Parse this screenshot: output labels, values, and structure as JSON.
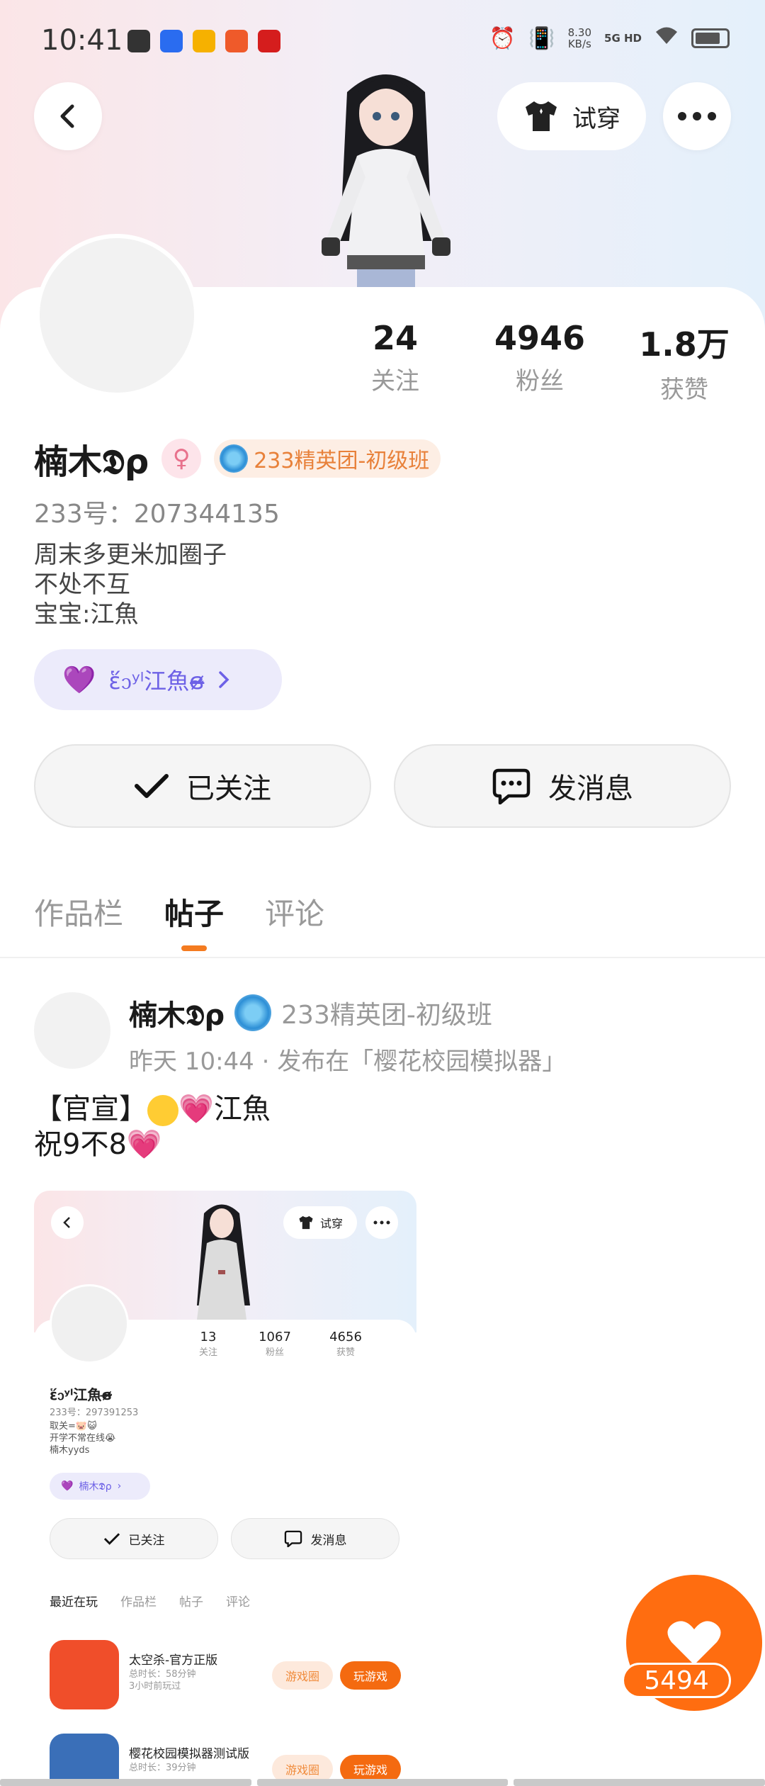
{
  "status_bar": {
    "time": "10:41",
    "net_speed_value": "8.30",
    "net_speed_unit": "KB/s",
    "network": "5G HD"
  },
  "header": {
    "try_on_label": "试穿"
  },
  "profile": {
    "stats": [
      {
        "value": "24",
        "label": "关注"
      },
      {
        "value": "4946",
        "label": "粉丝"
      },
      {
        "value": "1.8万",
        "label": "获赞"
      }
    ],
    "name": "楠木𝕯ρ",
    "rank_badge": "233精英团-初级班",
    "uid": "233号：207344135",
    "bio": [
      "周末多更米加圈子",
      "不处不互",
      "宝宝:江魚"
    ],
    "cp_name": "ἕ᧑ʸˡ江魚ɞ̴̶̷",
    "follow_label": "已关注",
    "message_label": "发消息"
  },
  "tabs": [
    {
      "label": "作品栏",
      "active": false
    },
    {
      "label": "帖子",
      "active": true
    },
    {
      "label": "评论",
      "active": false
    }
  ],
  "post": {
    "author": "楠木𝕯ρ",
    "rank": "233精英团-初级班",
    "meta": "昨天 10:44 · 发布在「樱花校园模拟器」",
    "line1_prefix": "【官宣】",
    "line1_suffix": "江魚",
    "line2": "祝9不8"
  },
  "embedded": {
    "try_on_label": "试穿",
    "stats": [
      {
        "value": "13",
        "label": "关注"
      },
      {
        "value": "1067",
        "label": "粉丝"
      },
      {
        "value": "4656",
        "label": "获赞"
      }
    ],
    "name": "ἕ᧑ʸˡ江魚ɞ̴̶̷",
    "uid": "233号：297391253",
    "bio": [
      "取关=🐷😺",
      "开学不常在线😭",
      "楠木yyds"
    ],
    "cp_name": "楠木𝕯ρ",
    "follow_label": "已关注",
    "message_label": "发消息",
    "tabs": [
      "最近在玩",
      "作品栏",
      "帖子",
      "评论"
    ],
    "games": [
      {
        "title": "太空杀-官方正版",
        "duration": "总时长：58分钟",
        "last_played": "3小时前玩过",
        "circle_label": "游戏圈",
        "play_label": "玩游戏"
      },
      {
        "title": "樱花校园模拟器测试版",
        "duration": "总时长：39分钟",
        "last_played": "",
        "circle_label": "游戏圈",
        "play_label": "玩游戏"
      }
    ]
  },
  "like": {
    "count": "5494"
  },
  "colors": {
    "accent_orange": "#ff6d10",
    "cp_purple": "#6d61e6",
    "rank_orange": "#e8813a"
  }
}
